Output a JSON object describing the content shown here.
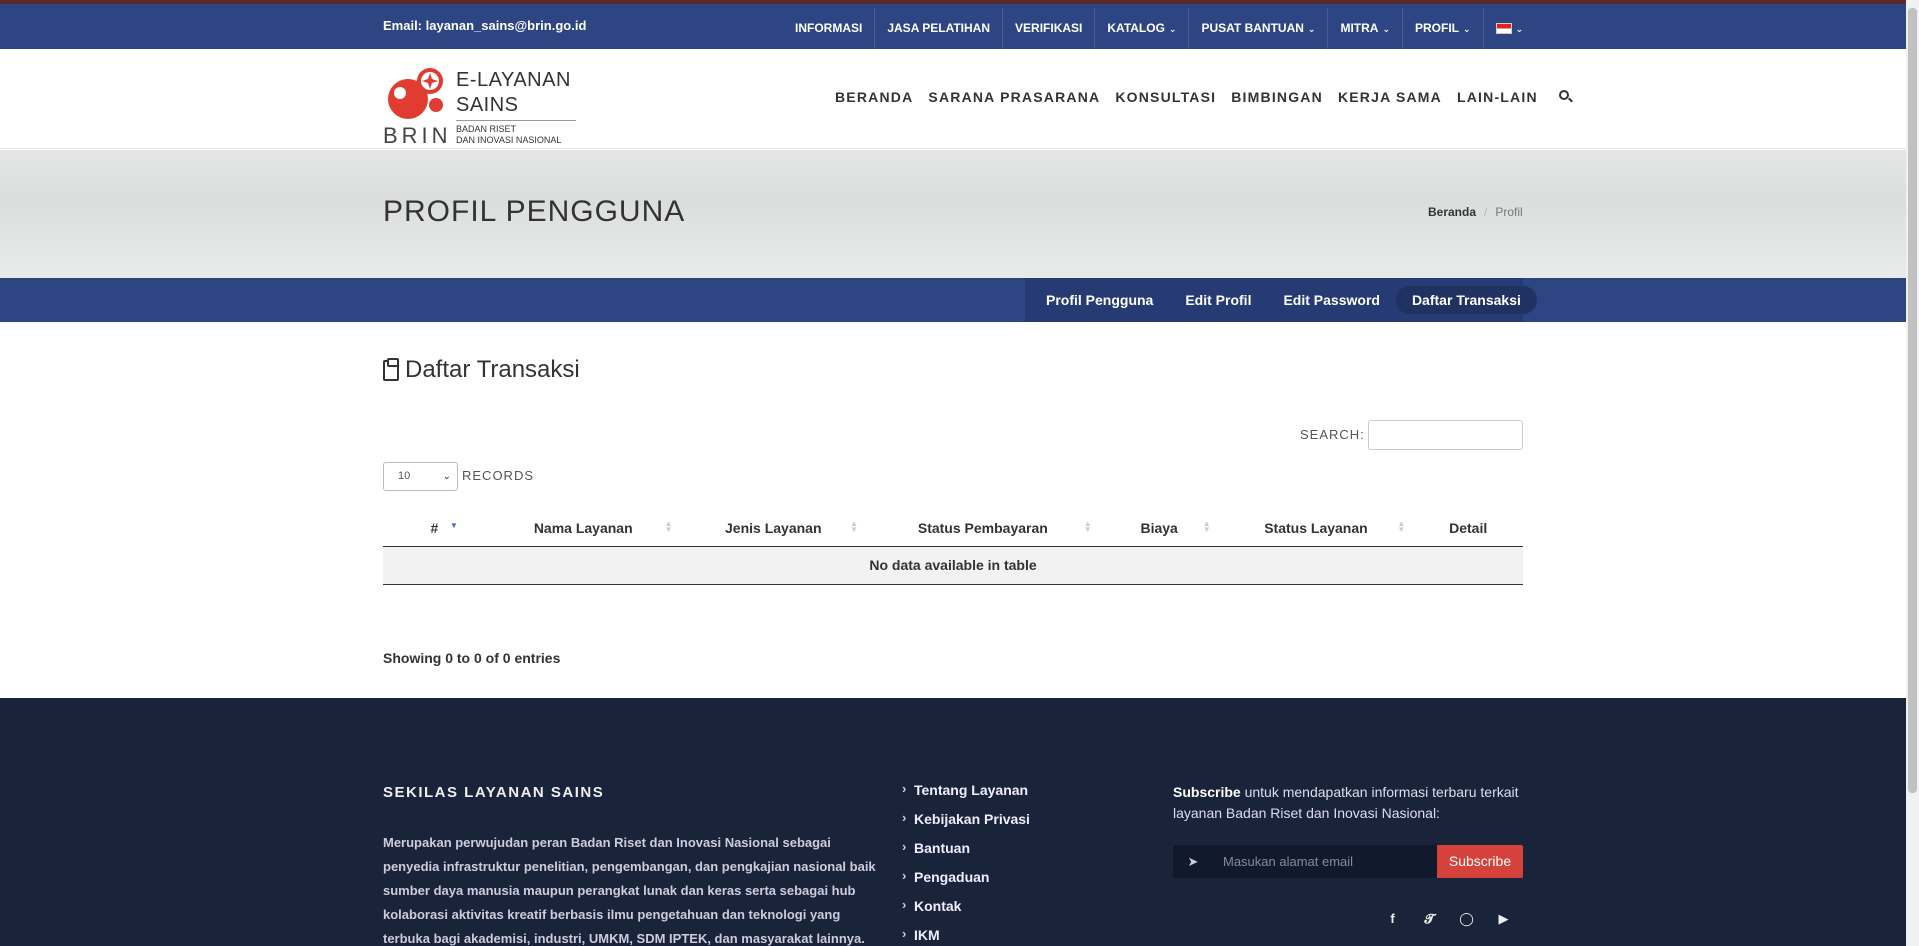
{
  "topbar": {
    "email": "Email: layanan_sains@brin.go.id",
    "menu": [
      {
        "label": "INFORMASI",
        "dropdown": false
      },
      {
        "label": "JASA PELATIHAN",
        "dropdown": false
      },
      {
        "label": "VERIFIKASI",
        "dropdown": false
      },
      {
        "label": "KATALOG",
        "dropdown": true
      },
      {
        "label": "PUSAT BANTUAN",
        "dropdown": true
      },
      {
        "label": "MITRA",
        "dropdown": true
      },
      {
        "label": "PROFIL",
        "dropdown": true
      }
    ],
    "language_icon": "indonesia-flag-icon"
  },
  "logo": {
    "line1": "E-LAYANAN",
    "line2": "SAINS",
    "brand": "BRIN",
    "sub1": "BADAN RISET",
    "sub2": "DAN INOVASI NASIONAL"
  },
  "mainmenu": [
    "BERANDA",
    "SARANA PRASARANA",
    "KONSULTASI",
    "BIMBINGAN",
    "KERJA SAMA",
    "LAIN-LAIN"
  ],
  "pagetitle": {
    "title": "PROFIL PENGGUNA",
    "breadcrumb_home": "Beranda",
    "breadcrumb_sep": "/",
    "breadcrumb_current": "Profil"
  },
  "subnav": {
    "tabs": [
      "Profil Pengguna",
      "Edit Profil",
      "Edit Password",
      "Daftar Transaksi"
    ],
    "active": "Daftar Transaksi"
  },
  "content": {
    "title": "Daftar Transaksi",
    "search_label": "SEARCH:",
    "search_value": "",
    "length_value": "10",
    "records_label": "RECORDS",
    "columns": [
      "#",
      "Nama Layanan",
      "Jenis Layanan",
      "Status Pembayaran",
      "Biaya",
      "Status Layanan",
      "Detail"
    ],
    "empty_message": "No data available in table",
    "info": "Showing 0 to 0 of 0 entries"
  },
  "footer": {
    "heading": "SEKILAS LAYANAN SAINS",
    "about": "Merupakan perwujudan peran Badan Riset dan Inovasi Nasional sebagai penyedia infrastruktur penelitian, pengembangan, dan pengkajian nasional baik sumber daya manusia maupun perangkat lunak dan keras serta sebagai hub kolaborasi aktivitas kreatif berbasis ilmu pengetahuan dan teknologi yang terbuka bagi akademisi, industri, UMKM, SDM IPTEK, dan masyarakat lainnya.",
    "links": [
      "Tentang Layanan",
      "Kebijakan Privasi",
      "Bantuan",
      "Pengaduan",
      "Kontak",
      "IKM"
    ],
    "subscribe_bold": "Subscribe",
    "subscribe_text": " untuk mendapatkan informasi terbaru terkait layanan Badan Riset dan Inovasi Nasional:",
    "email_placeholder": "Masukan alamat email",
    "subscribe_button": "Subscribe",
    "socials": [
      "facebook-icon",
      "twitter-icon",
      "instagram-icon",
      "youtube-icon"
    ]
  },
  "colors": {
    "primary_blue": "#2e4584",
    "footer_bg": "#19233a",
    "subscribe_red": "#d5423b",
    "logo_red": "#e03c31"
  }
}
